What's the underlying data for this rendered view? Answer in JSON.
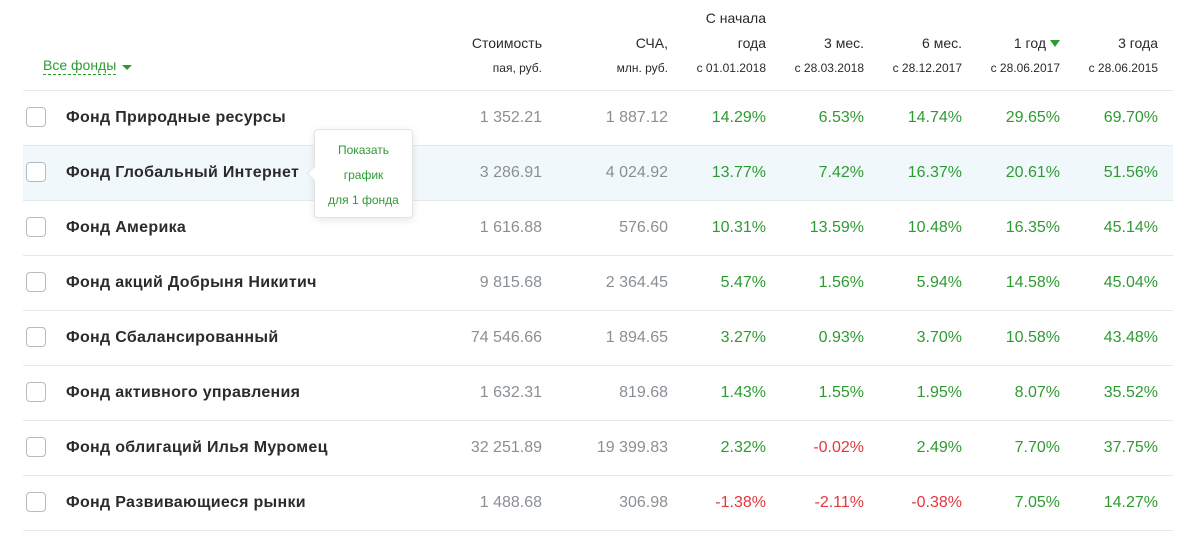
{
  "filter": {
    "label": "Все фонды"
  },
  "columns": [
    {
      "key": "price",
      "l1": "",
      "l2": "Стоимость",
      "l3": "пая, руб.",
      "sorted": false
    },
    {
      "key": "nav",
      "l1": "",
      "l2": "СЧА,",
      "l3": "млн. руб.",
      "sorted": false
    },
    {
      "key": "ytd",
      "l1": "С начала",
      "l2": "года",
      "l3": "с 01.01.2018",
      "sorted": false
    },
    {
      "key": "m3",
      "l1": "",
      "l2": "3 мес.",
      "l3": "с 28.03.2018",
      "sorted": false
    },
    {
      "key": "m6",
      "l1": "",
      "l2": "6 мес.",
      "l3": "с 28.12.2017",
      "sorted": false
    },
    {
      "key": "y1",
      "l1": "",
      "l2": "1 год",
      "l3": "с 28.06.2017",
      "sorted": true
    },
    {
      "key": "y3",
      "l1": "",
      "l2": "3 года",
      "l3": "с 28.06.2015",
      "sorted": false
    }
  ],
  "rows": [
    {
      "name": "Фонд Природные ресурсы",
      "price": "1 352.21",
      "nav": "1 887.12",
      "ytd": "14.29%",
      "m3": "6.53%",
      "m6": "14.74%",
      "y1": "29.65%",
      "y3": "69.70%"
    },
    {
      "name": "Фонд Глобальный Интернет",
      "price": "3 286.91",
      "nav": "4 024.92",
      "ytd": "13.77%",
      "m3": "7.42%",
      "m6": "16.37%",
      "y1": "20.61%",
      "y3": "51.56%"
    },
    {
      "name": "Фонд Америка",
      "price": "1 616.88",
      "nav": "576.60",
      "ytd": "10.31%",
      "m3": "13.59%",
      "m6": "10.48%",
      "y1": "16.35%",
      "y3": "45.14%"
    },
    {
      "name": "Фонд акций Добрыня Никитич",
      "price": "9 815.68",
      "nav": "2 364.45",
      "ytd": "5.47%",
      "m3": "1.56%",
      "m6": "5.94%",
      "y1": "14.58%",
      "y3": "45.04%"
    },
    {
      "name": "Фонд Сбалансированный",
      "price": "74 546.66",
      "nav": "1 894.65",
      "ytd": "3.27%",
      "m3": "0.93%",
      "m6": "3.70%",
      "y1": "10.58%",
      "y3": "43.48%"
    },
    {
      "name": "Фонд активного управления",
      "price": "1 632.31",
      "nav": "819.68",
      "ytd": "1.43%",
      "m3": "1.55%",
      "m6": "1.95%",
      "y1": "8.07%",
      "y3": "35.52%"
    },
    {
      "name": "Фонд облигаций Илья Муромец",
      "price": "32 251.89",
      "nav": "19 399.83",
      "ytd": "2.32%",
      "m3": "-0.02%",
      "m6": "2.49%",
      "y1": "7.70%",
      "y3": "37.75%"
    },
    {
      "name": "Фонд Развивающиеся рынки",
      "price": "1 488.68",
      "nav": "306.98",
      "ytd": "-1.38%",
      "m3": "-2.11%",
      "m6": "-0.38%",
      "y1": "7.05%",
      "y3": "14.27%"
    }
  ],
  "tooltip": {
    "line1": "Показать",
    "line2": "график",
    "line3": "для 1 фонда"
  },
  "colors": {
    "positive": "#2e9b32",
    "negative": "#e0383e",
    "accent": "#2e9b32",
    "highlight_row": "#f1f8fc"
  }
}
